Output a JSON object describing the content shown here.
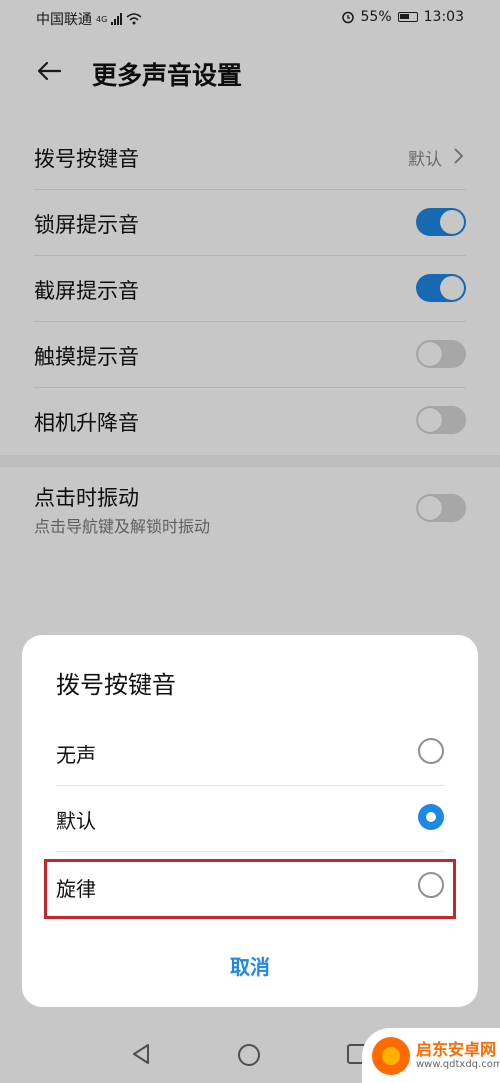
{
  "status_bar": {
    "carrier": "中国联通",
    "network": "4G",
    "alarm_icon": "alarm-icon",
    "battery_percent": "55%",
    "time": "13:03"
  },
  "header": {
    "title": "更多声音设置",
    "back_icon": "arrow-left-icon"
  },
  "settings": {
    "dial_tone": {
      "label": "拨号按键音",
      "value": "默认"
    },
    "lock_sound": {
      "label": "锁屏提示音",
      "enabled": true
    },
    "screenshot_sound": {
      "label": "截屏提示音",
      "enabled": true
    },
    "touch_sound": {
      "label": "触摸提示音",
      "enabled": false
    },
    "camera_lift_sound": {
      "label": "相机升降音",
      "enabled": false
    },
    "vibrate_on_tap": {
      "label": "点击时振动",
      "subtitle": "点击导航键及解锁时振动",
      "enabled": false
    }
  },
  "dialog": {
    "title": "拨号按键音",
    "options": [
      {
        "label": "无声",
        "selected": false
      },
      {
        "label": "默认",
        "selected": true
      },
      {
        "label": "旋律",
        "selected": false,
        "highlighted": true
      }
    ],
    "cancel_label": "取消"
  },
  "navbar": {
    "back_icon": "triangle-back-icon",
    "home_icon": "circle-home-icon",
    "recents_icon": "square-recents-icon"
  },
  "watermark": {
    "title": "启东安卓网",
    "url": "www.qdtxdq.com"
  },
  "colors": {
    "accent": "#1e88e5",
    "highlight": "#c2272d",
    "toggle_off": "#d7d7d7"
  }
}
